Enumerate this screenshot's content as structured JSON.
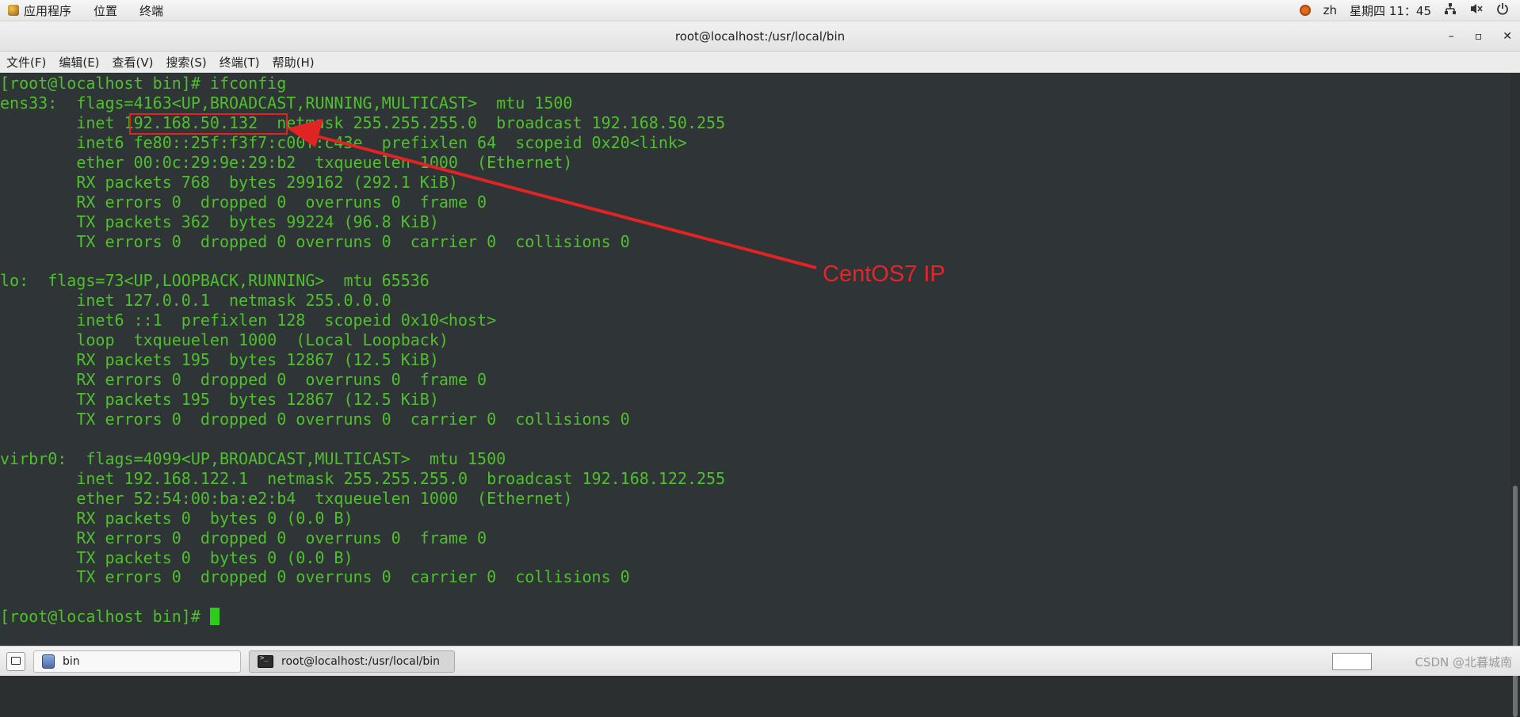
{
  "topbar": {
    "menus": [
      "应用程序",
      "位置",
      "终端"
    ],
    "lang": "zh",
    "clock": "星期四 11：45"
  },
  "window": {
    "title": "root@localhost:/usr/local/bin",
    "controls": {
      "minimize": "–",
      "maximize": "▫",
      "close": "✕"
    }
  },
  "menubar": [
    "文件(F)",
    "编辑(E)",
    "查看(V)",
    "搜索(S)",
    "终端(T)",
    "帮助(H)"
  ],
  "terminal": {
    "lines": [
      "[root@localhost bin]# ifconfig",
      "ens33:  flags=4163<UP,BROADCAST,RUNNING,MULTICAST>  mtu 1500",
      "        inet 192.168.50.132  netmask 255.255.255.0  broadcast 192.168.50.255",
      "        inet6 fe80::25f:f3f7:c00f:c43e  prefixlen 64  scopeid 0x20<link>",
      "        ether 00:0c:29:9e:29:b2  txqueuelen 1000  (Ethernet)",
      "        RX packets 768  bytes 299162 (292.1 KiB)",
      "        RX errors 0  dropped 0  overruns 0  frame 0",
      "        TX packets 362  bytes 99224 (96.8 KiB)",
      "        TX errors 0  dropped 0 overruns 0  carrier 0  collisions 0",
      "",
      "lo:  flags=73<UP,LOOPBACK,RUNNING>  mtu 65536",
      "        inet 127.0.0.1  netmask 255.0.0.0",
      "        inet6 ::1  prefixlen 128  scopeid 0x10<host>",
      "        loop  txqueuelen 1000  (Local Loopback)",
      "        RX packets 195  bytes 12867 (12.5 KiB)",
      "        RX errors 0  dropped 0  overruns 0  frame 0",
      "        TX packets 195  bytes 12867 (12.5 KiB)",
      "        TX errors 0  dropped 0 overruns 0  carrier 0  collisions 0",
      "",
      "virbr0:  flags=4099<UP,BROADCAST,MULTICAST>  mtu 1500",
      "        inet 192.168.122.1  netmask 255.255.255.0  broadcast 192.168.122.255",
      "        ether 52:54:00:ba:e2:b4  txqueuelen 1000  (Ethernet)",
      "        RX packets 0  bytes 0 (0.0 B)",
      "        RX errors 0  dropped 0  overruns 0  frame 0",
      "        TX packets 0  bytes 0 (0.0 B)",
      "        TX errors 0  dropped 0 overruns 0  carrier 0  collisions 0",
      ""
    ],
    "prompt": "[root@localhost bin]# "
  },
  "annotation": {
    "label": "CentOS7 IP",
    "color": "#e5252a"
  },
  "taskbar": {
    "tasks": [
      {
        "label": "bin",
        "icon": "folder-icon",
        "active": false
      },
      {
        "label": "root@localhost:/usr/local/bin",
        "icon": "terminal-icon",
        "active": true
      }
    ],
    "watermark": "CSDN @北暮城南"
  }
}
